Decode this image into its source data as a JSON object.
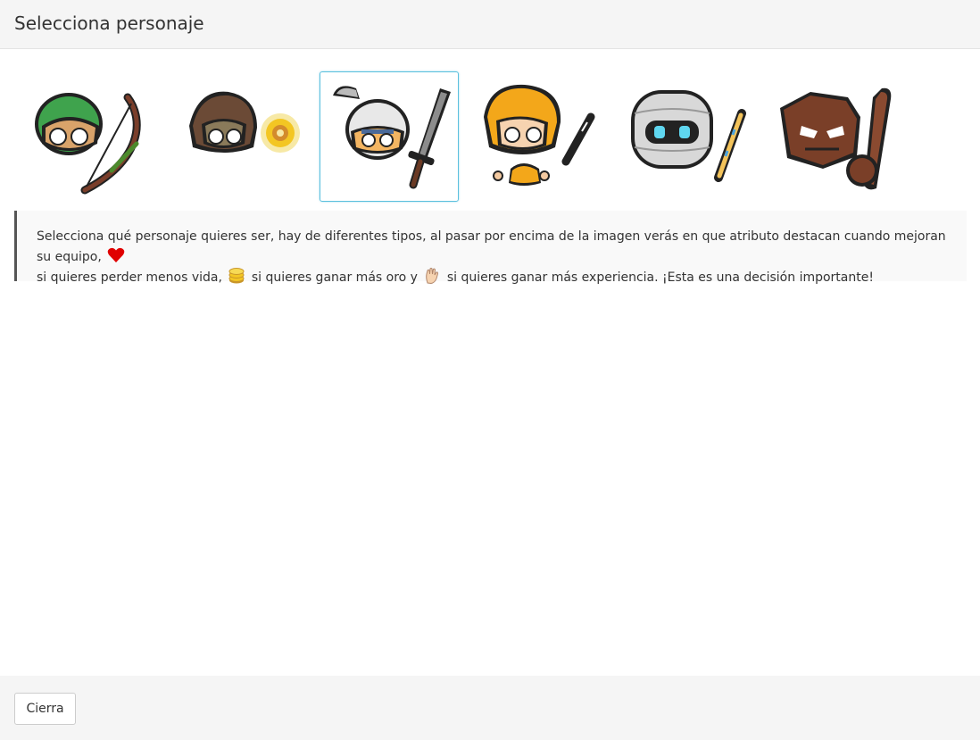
{
  "modal": {
    "title": "Selecciona personaje"
  },
  "characters": [
    {
      "name": "archer-character",
      "selected": false
    },
    {
      "name": "mage-character",
      "selected": false
    },
    {
      "name": "knight-character",
      "selected": true
    },
    {
      "name": "warrior-character",
      "selected": false
    },
    {
      "name": "robot-character",
      "selected": false
    },
    {
      "name": "golem-character",
      "selected": false
    }
  ],
  "info": {
    "part1": "Selecciona qué personaje quieres ser, hay de diferentes tipos, al pasar por encima de la imagen verás en que atributo destacan cuando mejoran su equipo,",
    "part2": "si quieres perder menos vida,",
    "part3": "si quieres ganar más oro y",
    "part4": "si quieres ganar más experiencia. ¡Esta es una decisión importante!",
    "icons": [
      "heart-icon",
      "coins-icon",
      "hand-icon"
    ]
  },
  "footer": {
    "close_label": "Cierra"
  },
  "colors": {
    "header_bg": "#f5f5f5",
    "selected_border": "#5bc0de",
    "heart": "#e00000",
    "coin": "#f3c623"
  }
}
